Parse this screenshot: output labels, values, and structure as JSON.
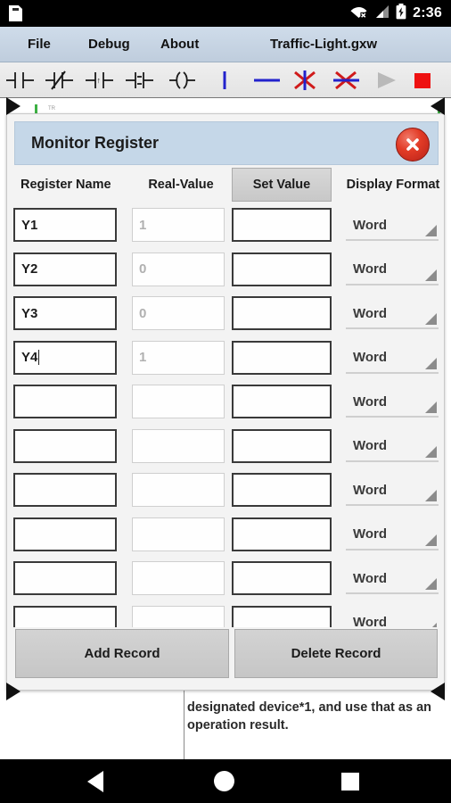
{
  "status_bar": {
    "time": "2:36",
    "icons": [
      "sd-card-icon",
      "wifi-disconnected-icon",
      "cell-signal-icon",
      "battery-charging-icon"
    ]
  },
  "menubar": {
    "items": [
      {
        "label": "File"
      },
      {
        "label": "Debug"
      },
      {
        "label": "About"
      }
    ],
    "filename": "Traffic-Light.gxw"
  },
  "toolbar": {
    "icons": [
      "no-contact-icon",
      "nc-contact-icon",
      "rising-edge-contact-icon",
      "falling-edge-contact-icon",
      "coil-icon",
      "vertical-link-icon",
      "horizontal-link-icon",
      "delete-vertical-link-icon",
      "delete-horizontal-link-icon",
      "run-icon",
      "stop-icon"
    ]
  },
  "canvas": {
    "doc_text": "designated device*1, and use that as an operation result."
  },
  "dialog": {
    "title": "Monitor Register",
    "close_icon": "close-icon",
    "headers": {
      "register_name": "Register Name",
      "real_value": "Real-Value",
      "set_value": "Set Value",
      "display_format": "Display Format"
    },
    "rows": [
      {
        "register_name": "Y1",
        "real_value": "1",
        "set_value": "",
        "display_format": "Word",
        "focused": false
      },
      {
        "register_name": "Y2",
        "real_value": "0",
        "set_value": "",
        "display_format": "Word",
        "focused": false
      },
      {
        "register_name": "Y3",
        "real_value": "0",
        "set_value": "",
        "display_format": "Word",
        "focused": false
      },
      {
        "register_name": "Y4",
        "real_value": "1",
        "set_value": "",
        "display_format": "Word",
        "focused": true
      },
      {
        "register_name": "",
        "real_value": "",
        "set_value": "",
        "display_format": "Word",
        "focused": false
      },
      {
        "register_name": "",
        "real_value": "",
        "set_value": "",
        "display_format": "Word",
        "focused": false
      },
      {
        "register_name": "",
        "real_value": "",
        "set_value": "",
        "display_format": "Word",
        "focused": false
      },
      {
        "register_name": "",
        "real_value": "",
        "set_value": "",
        "display_format": "Word",
        "focused": false
      },
      {
        "register_name": "",
        "real_value": "",
        "set_value": "",
        "display_format": "Word",
        "focused": false
      },
      {
        "register_name": "",
        "real_value": "",
        "set_value": "",
        "display_format": "Word",
        "focused": false
      }
    ],
    "buttons": {
      "add_record": "Add Record",
      "delete_record": "Delete Record"
    }
  },
  "navbar": {
    "back": "back-icon",
    "home": "home-icon",
    "recents": "recents-icon"
  },
  "colors": {
    "titlebar": "#c5d7e8",
    "menubar": "#cfdcea",
    "close_red": "#e23b26",
    "stop_red": "#ee1111",
    "link_blue": "#2222cc",
    "rail_green": "#3cb043"
  }
}
